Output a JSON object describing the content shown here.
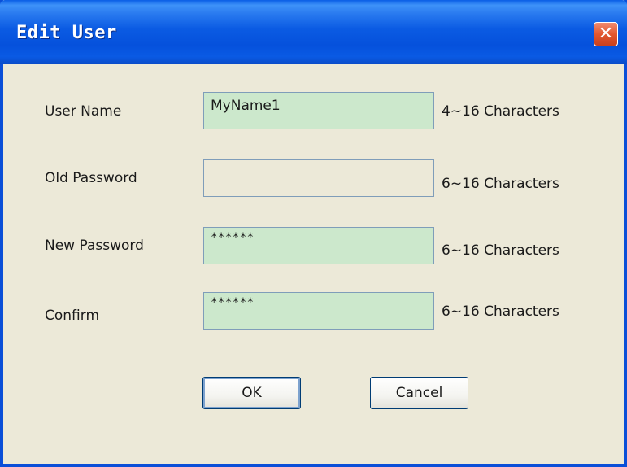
{
  "window": {
    "title": "Edit User",
    "close_glyph": "✕"
  },
  "form": {
    "user_name": {
      "label": "User Name",
      "value": "MyName1",
      "hint": "4~16 Characters"
    },
    "old_password": {
      "label": "Old Password",
      "value": "",
      "hint": "6~16 Characters"
    },
    "new_password": {
      "label": "New Password",
      "value": "******",
      "hint": "6~16 Characters"
    },
    "confirm": {
      "label": "Confirm",
      "value": "******",
      "hint": "6~16 Characters"
    }
  },
  "buttons": {
    "ok_label": "OK",
    "cancel_label": "Cancel"
  },
  "colors": {
    "titlebar": "#0A5EE6",
    "dialog_bg": "#ECE9D8",
    "field_filled_bg": "#CCE8CC",
    "close_button": "#E2572F"
  },
  "icons": {
    "close": "close-icon"
  }
}
